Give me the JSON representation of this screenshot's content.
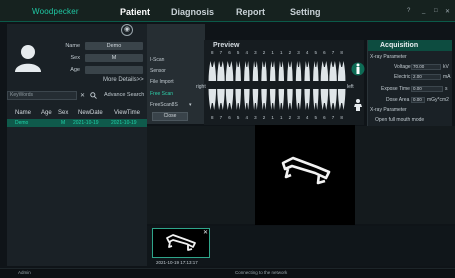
{
  "app": {
    "brand": "Woodpecker"
  },
  "nav": {
    "tabs": [
      "Patient",
      "Diagnosis",
      "Report",
      "Setting"
    ]
  },
  "window_controls": {
    "help": "?",
    "min": "_",
    "max": "□",
    "close": "✕"
  },
  "patient": {
    "name_label": "Name",
    "name_value": "Demo",
    "sex_label": "Sex",
    "sex_value": "M",
    "age_label": "Age",
    "age_value": "",
    "more_details": "More Details>>"
  },
  "search": {
    "placeholder": "KeyWords",
    "clear": "✕",
    "advanced": "Advance Search"
  },
  "table": {
    "headers": [
      "Name",
      "Age",
      "Sex",
      "NewDate",
      "ViewTime"
    ],
    "rows": [
      [
        "Demo",
        "",
        "M",
        "2021-10-19",
        "2021-10-19"
      ]
    ]
  },
  "modes": {
    "items": [
      "I-Scan",
      "Sensor",
      "File Import",
      "Free Scan",
      "FreeScan8S",
      "Close"
    ]
  },
  "preview": {
    "title": "Preview",
    "right": "right",
    "left": "left",
    "upper_numbers": [
      "8",
      "7",
      "6",
      "5",
      "4",
      "3",
      "2",
      "1",
      "1",
      "2",
      "3",
      "4",
      "5",
      "6",
      "7",
      "8"
    ],
    "lower_numbers": [
      "8",
      "7",
      "6",
      "5",
      "4",
      "3",
      "2",
      "1",
      "1",
      "2",
      "3",
      "4",
      "5",
      "6",
      "7",
      "8"
    ]
  },
  "acquisition": {
    "title": "Acquisition",
    "section1": "X-ray Parameter",
    "voltage_label": "Voltage",
    "voltage_value": "70.00",
    "voltage_unit": "kV",
    "electric_label": "Electric",
    "electric_value": "2.00",
    "electric_unit": "mA",
    "expose_label": "Expose Time",
    "expose_value": "0.00",
    "expose_unit": "s",
    "dose_label": "Dose Area",
    "dose_value": "0.00",
    "dose_unit": "mGy*cm2",
    "section2": "X-ray Parameter",
    "open_full": "Open full mouth mode"
  },
  "thumbnail": {
    "caption": "2021-10-19 17:13:17",
    "close": "✕"
  },
  "status": {
    "user": "Admin",
    "network": "Connecting to the network"
  },
  "colors": {
    "accent": "#1fc9a4",
    "selected_row": "#0f5a4b",
    "acq_header": "#0d4c40"
  }
}
